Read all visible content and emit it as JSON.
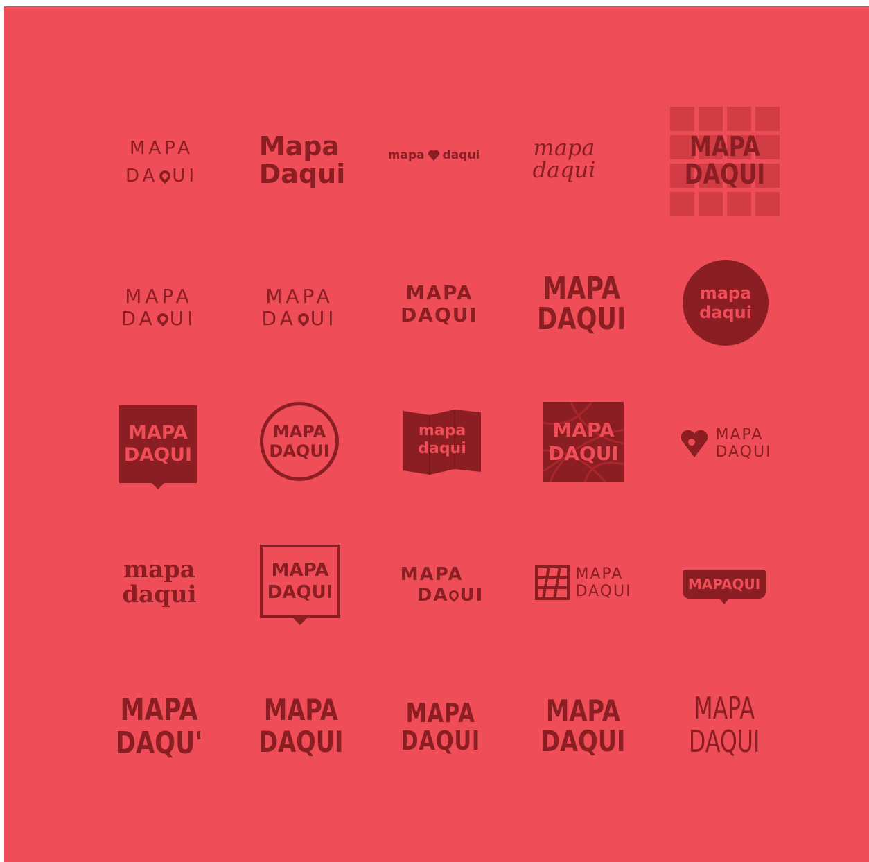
{
  "logos": [
    {
      "line1": "MAPA",
      "line2": "DA",
      "line3": "UI"
    },
    {
      "line1": "Mapa",
      "line2": "Daqui"
    },
    {
      "line1": "mapa",
      "line2": "daqui"
    },
    {
      "line1": "mapa",
      "line2": "daqui"
    },
    {
      "line1": "MAPA",
      "line2": "DAQUI"
    },
    {
      "line1": "MAPA",
      "line2": "DA",
      "line3": "UI"
    },
    {
      "line1": "MAPA",
      "line2": "DA",
      "line3": "UI"
    },
    {
      "line1": "MAPA",
      "line2": "DAQUI"
    },
    {
      "line1": "MAPA",
      "line2": "DAQUI"
    },
    {
      "line1": "mapa",
      "line2": "daqui"
    },
    {
      "line1": "MAPA",
      "line2": "DAQUI"
    },
    {
      "line1": "MAPA",
      "line2": "DAQUI"
    },
    {
      "line1": "mapa",
      "line2": "daqui"
    },
    {
      "line1": "MAPA",
      "line2": "DAQUI"
    },
    {
      "line1": "MAPA",
      "line2": "DAQUI"
    },
    {
      "line1": "mapa",
      "line2": "daqui"
    },
    {
      "line1": "MAPA",
      "line2": "DAQUI"
    },
    {
      "line1": "MAPA",
      "line2": "DA",
      "line3": "UI"
    },
    {
      "line1": "MAPA",
      "line2": "DAQUI"
    },
    {
      "line1": "MAPAQUI"
    },
    {
      "line1": "MAPA",
      "line2": "DAQU'"
    },
    {
      "line1": "MAPA",
      "line2": "DAQUI"
    },
    {
      "line1": "MAPA",
      "line2": "DAQUI"
    },
    {
      "line1": "MAPA",
      "line2": "DAQUI"
    },
    {
      "line1": "MAPA",
      "line2": "DAQUI"
    }
  ],
  "colors": {
    "background": "#ef4d57",
    "mark": "#8b1e22",
    "frame": "#ffffff"
  }
}
